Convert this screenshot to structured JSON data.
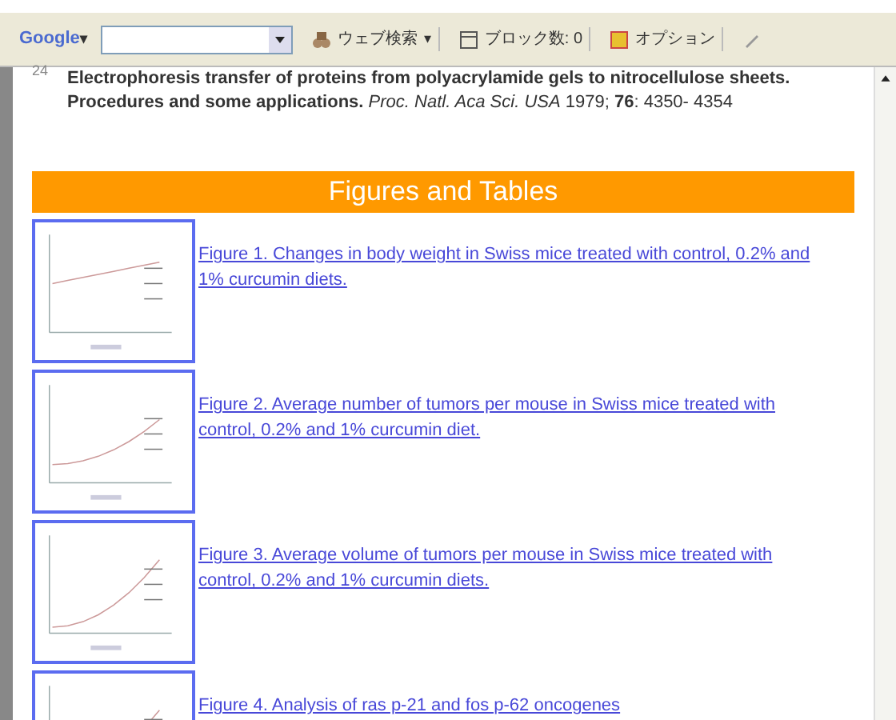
{
  "toolbar": {
    "logo": "Google",
    "logo_caret": "▾",
    "buttons": [
      {
        "kind": "search",
        "label": "ウェブ検索",
        "caret": "▾"
      },
      {
        "kind": "block",
        "label": "ブロック数: 0"
      },
      {
        "kind": "options",
        "label": "オプション"
      },
      {
        "kind": "pen"
      }
    ]
  },
  "reference": {
    "number": "24",
    "text": "**Electrophoresis transfer of proteins from polyacrylamide gels to nitrocellulose sheets. Procedures and some applications.** *Proc. Natl. Aca Sci. USA* 1979; **76**: 4350- 4354"
  },
  "section_title": "Figures and Tables",
  "figures": [
    {
      "caption": "Figure 1. Changes in body weight in Swiss mice treated with control, 0.2% and 1% curcumin diets."
    },
    {
      "caption": "Figure 2. Average number of tumors per mouse in Swiss mice treated with control, 0.2% and 1% curcumin diet."
    },
    {
      "caption": "Figure 3. Average volume of tumors per mouse in Swiss mice treated with control, 0.2% and 1% curcumin diets."
    },
    {
      "caption": "Figure 4. Analysis of ras p-21 and fos p-62 oncogenes"
    }
  ]
}
